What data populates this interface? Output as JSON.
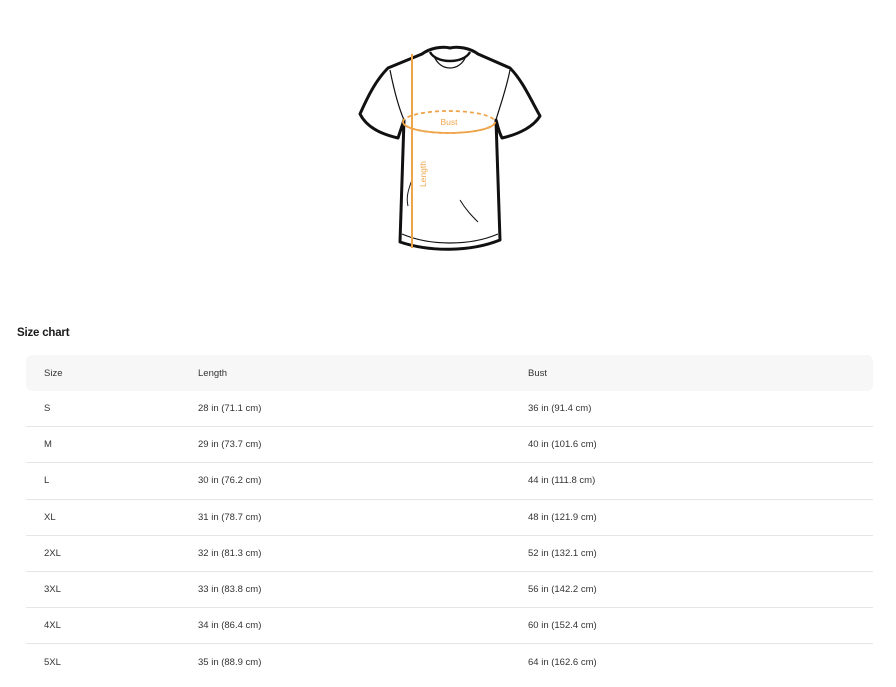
{
  "illustration": {
    "bust_label": "Bust",
    "length_label": "Length",
    "accent_color": "#f0a44a"
  },
  "size_chart": {
    "title": "Size chart",
    "headers": {
      "size": "Size",
      "length": "Length",
      "bust": "Bust"
    },
    "rows": [
      {
        "size": "S",
        "length": "28 in  (71.1 cm)",
        "bust": "36 in  (91.4 cm)"
      },
      {
        "size": "M",
        "length": "29 in  (73.7 cm)",
        "bust": "40 in  (101.6 cm)"
      },
      {
        "size": "L",
        "length": "30 in  (76.2 cm)",
        "bust": "44 in  (111.8 cm)"
      },
      {
        "size": "XL",
        "length": "31 in  (78.7 cm)",
        "bust": "48 in  (121.9 cm)"
      },
      {
        "size": "2XL",
        "length": "32 in  (81.3 cm)",
        "bust": "52 in  (132.1 cm)"
      },
      {
        "size": "3XL",
        "length": "33 in  (83.8 cm)",
        "bust": "56 in  (142.2 cm)"
      },
      {
        "size": "4XL",
        "length": "34 in  (86.4 cm)",
        "bust": "60 in  (152.4 cm)"
      },
      {
        "size": "5XL",
        "length": "35 in  (88.9 cm)",
        "bust": "64 in  (162.6 cm)"
      }
    ]
  }
}
